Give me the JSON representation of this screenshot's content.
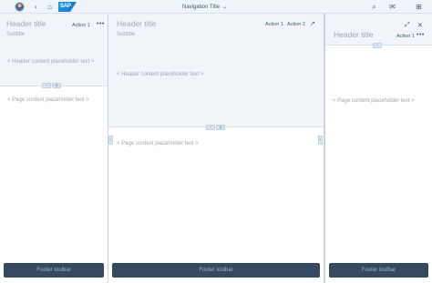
{
  "shell": {
    "navigation_title": "Navigation Title",
    "logo_text": "SAP"
  },
  "columns": {
    "begin": {
      "title": "Header title",
      "subtitle": "Subtitle",
      "action1": "Action 1",
      "more": "•••",
      "header_placeholder": "< Header content placeholder text >",
      "content_placeholder": "< Page content placeholder text >",
      "footer": "Footer toolbar"
    },
    "mid": {
      "title": "Header title",
      "subtitle": "Subtitle",
      "action1": "Action 1",
      "action2": "Action 2",
      "header_placeholder": "< Header content placeholder text >",
      "content_placeholder": "< Page content placeholder text >",
      "footer": "Footer toolbar"
    },
    "end": {
      "title": "Header title",
      "action1": "Action 1",
      "more": "•••",
      "content_placeholder": "< Page content placeholder text >",
      "footer": "Footer toolbar"
    }
  },
  "icons": {
    "collapse": "^",
    "pin": "⊘",
    "arrow_left": "‹",
    "arrow_right": "›",
    "back": "‹",
    "home": "⌂",
    "search": "⌕",
    "notifications": "✉",
    "grid": "⊞",
    "fullscreen": "⤢",
    "close": "✕",
    "external": "↗",
    "chevron_down": "⌄"
  }
}
